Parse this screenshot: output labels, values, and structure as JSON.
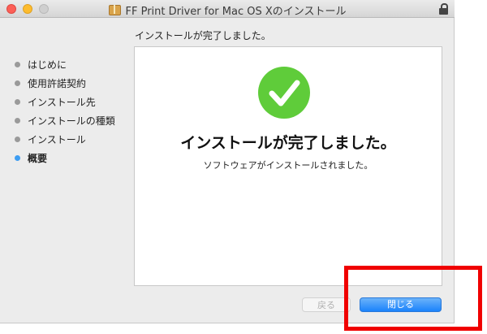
{
  "window": {
    "title": "FF Print Driver for Mac OS Xのインストール"
  },
  "header": {
    "text": "インストールが完了しました。"
  },
  "sidebar": {
    "items": [
      {
        "label": "はじめに"
      },
      {
        "label": "使用許諾契約"
      },
      {
        "label": "インストール先"
      },
      {
        "label": "インストールの種類"
      },
      {
        "label": "インストール"
      },
      {
        "label": "概要",
        "active": true
      }
    ]
  },
  "content": {
    "title": "インストールが完了しました。",
    "subtitle": "ソフトウェアがインストールされました。"
  },
  "buttons": {
    "back": "戻る",
    "close": "閉じる"
  },
  "colors": {
    "accent": "#1a82fb",
    "success": "#5fcc3a",
    "highlight": "#f00000"
  },
  "icons": [
    "package-icon",
    "lock-icon",
    "checkmark-icon"
  ]
}
